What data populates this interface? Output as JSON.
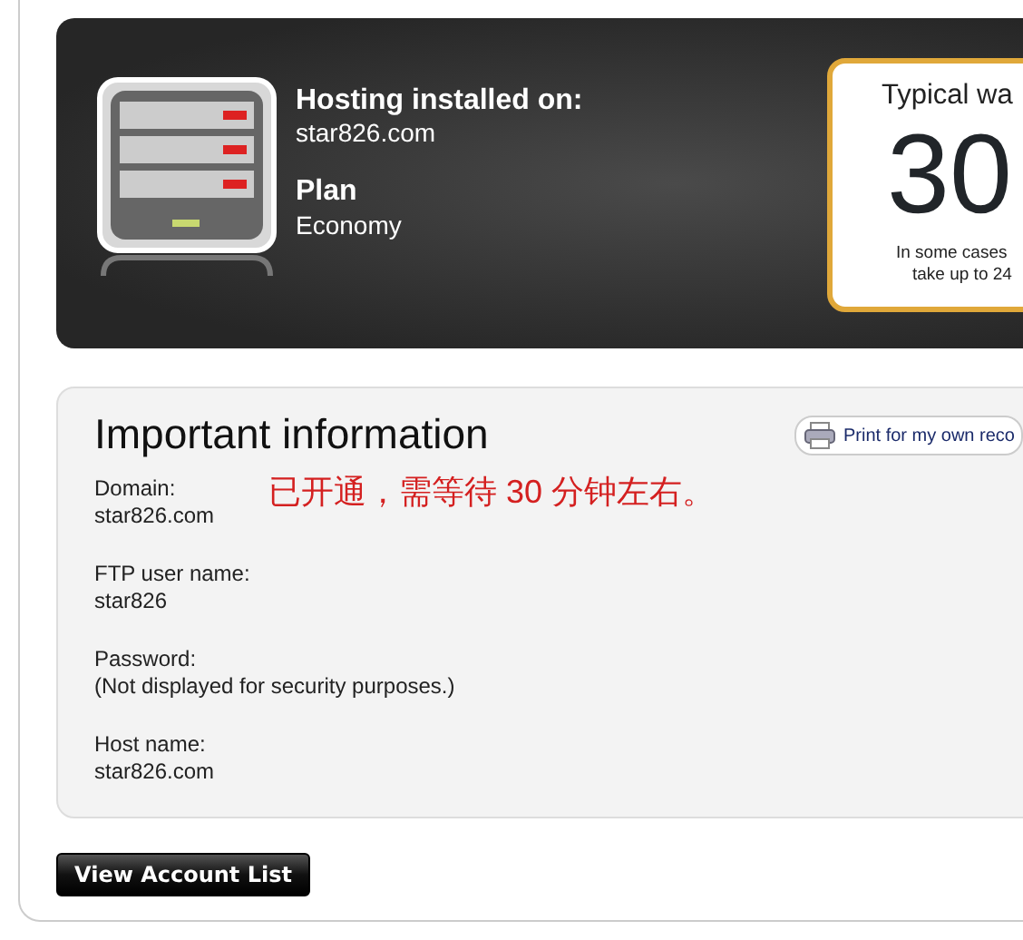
{
  "banner": {
    "hosting_label": "Hosting installed on:",
    "hosting_value": "star826.com",
    "plan_label": "Plan",
    "plan_value": "Economy",
    "wait_card": {
      "title": "Typical wa",
      "big": "30",
      "note_lines": [
        "In some cases",
        "take up to 24"
      ]
    }
  },
  "info": {
    "title": "Important information",
    "print_button": "Print for my own reco",
    "note": "已开通，需等待 30 分钟左右。",
    "fields": [
      {
        "label": "Domain:",
        "value": "star826.com"
      },
      {
        "label": "FTP user name:",
        "value": "star826"
      },
      {
        "label": "Password:",
        "value": "(Not displayed for security purposes.)"
      },
      {
        "label": "Host name:",
        "value": "star826.com"
      }
    ]
  },
  "buttons": [
    {
      "label": "View Account List"
    }
  ]
}
